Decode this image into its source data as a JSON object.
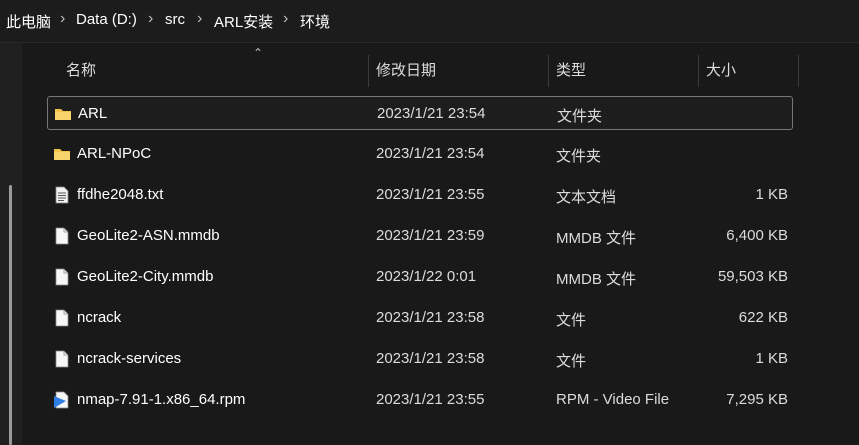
{
  "breadcrumb": [
    "此电脑",
    "Data (D:)",
    "src",
    "ARL安装",
    "环境"
  ],
  "columns": {
    "name": "名称",
    "modified": "修改日期",
    "type": "类型",
    "size": "大小"
  },
  "files": [
    {
      "name": "ARL",
      "date": "2023/1/21 23:54",
      "type": "文件夹",
      "size": "",
      "icon": "folder-icon"
    },
    {
      "name": "ARL-NPoC",
      "date": "2023/1/21 23:54",
      "type": "文件夹",
      "size": "",
      "icon": "folder-icon"
    },
    {
      "name": "ffdhe2048.txt",
      "date": "2023/1/21 23:55",
      "type": "文本文档",
      "size": "1 KB",
      "icon": "text-file-icon"
    },
    {
      "name": "GeoLite2-ASN.mmdb",
      "date": "2023/1/21 23:59",
      "type": "MMDB 文件",
      "size": "6,400 KB",
      "icon": "file-icon"
    },
    {
      "name": "GeoLite2-City.mmdb",
      "date": "2023/1/22 0:01",
      "type": "MMDB 文件",
      "size": "59,503 KB",
      "icon": "file-icon"
    },
    {
      "name": "ncrack",
      "date": "2023/1/21 23:58",
      "type": "文件",
      "size": "622 KB",
      "icon": "file-icon"
    },
    {
      "name": "ncrack-services",
      "date": "2023/1/21 23:58",
      "type": "文件",
      "size": "1 KB",
      "icon": "file-icon"
    },
    {
      "name": "nmap-7.91-1.x86_64.rpm",
      "date": "2023/1/21 23:55",
      "type": "RPM - Video File",
      "size": "7,295 KB",
      "icon": "video-file-icon"
    }
  ],
  "colors": {
    "background": "#191919",
    "folder": "#f3c24c",
    "selection_border": "#777777",
    "video_icon": "#2f7ee6"
  }
}
